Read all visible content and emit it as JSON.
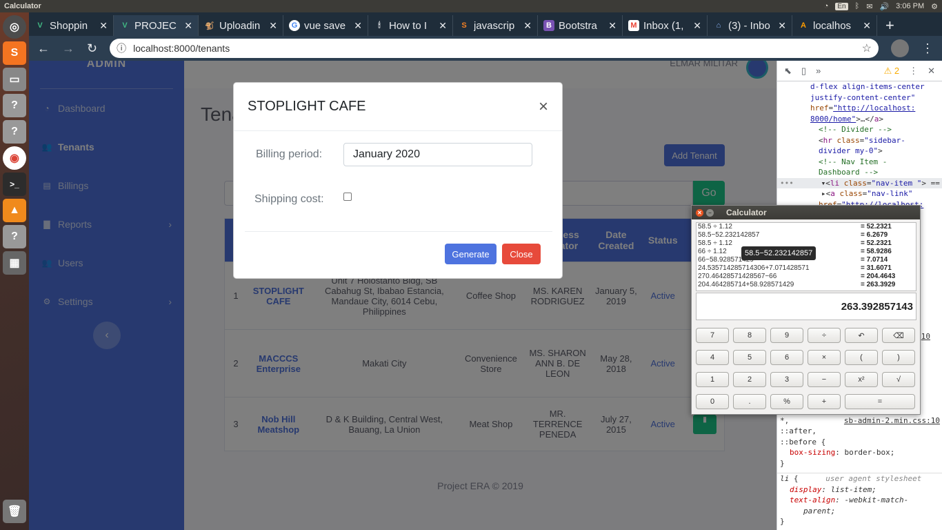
{
  "topbar": {
    "title": "Calculator",
    "kbd": "En",
    "time": "3:06 PM"
  },
  "launcher": [
    "ubuntu-icon",
    "sublime-icon",
    "files-icon",
    "unknown-icon",
    "unknown-icon",
    "chrome-icon",
    "terminal-icon",
    "vlc-icon",
    "unknown-icon",
    "calculator-icon",
    "trash-icon"
  ],
  "tabs": [
    {
      "label": "Shoppin",
      "icon": "V",
      "color": "#41b883"
    },
    {
      "label": "PROJEC",
      "icon": "V",
      "color": "#41b883"
    },
    {
      "label": "Uploadin",
      "icon": "🐒",
      "color": "#f3e2c5"
    },
    {
      "label": "vue save",
      "icon": "G",
      "color": "#ffffff"
    },
    {
      "label": "How to I",
      "icon": "🕯",
      "color": "#2c3e50"
    },
    {
      "label": "javascrip",
      "icon": "S",
      "color": "#f48024"
    },
    {
      "label": "Bootstra",
      "icon": "B",
      "color": "#7952b3"
    },
    {
      "label": "Inbox (1,",
      "icon": "M",
      "color": "#ea4335"
    },
    {
      "label": "(3) - Inbo",
      "icon": "⌂",
      "color": "#8ab4f8"
    },
    {
      "label": "localhos",
      "icon": "A",
      "color": "#ff9c00"
    }
  ],
  "address": {
    "url": "localhost:8000/tenants"
  },
  "sidebar": {
    "brand": "ADMIN",
    "items": [
      {
        "label": "Dashboard",
        "icon": "◔"
      },
      {
        "label": "Tenants",
        "icon": "👥"
      },
      {
        "label": "Billings",
        "icon": "▤"
      },
      {
        "label": "Reports",
        "icon": "▇",
        "chev": "›"
      },
      {
        "label": "Users",
        "icon": "👥"
      },
      {
        "label": "Settings",
        "icon": "⚙",
        "chev": "›"
      }
    ],
    "toggle": "‹"
  },
  "topnav": {
    "user": "ELMAR MILITAR"
  },
  "main": {
    "title": "Tenants",
    "add_tenant": "Add Tenant",
    "go": "Go"
  },
  "table": {
    "headers": [
      "",
      "",
      "",
      "",
      "Business Operator",
      "Date Created",
      "Status",
      ""
    ],
    "rows": [
      {
        "no": "1",
        "name": "STOPLIGHT CAFE",
        "address": "Unit 7 Holostanto Bldg, SB Cabahug St, Ibabao Estancia, Mandaue City, 6014 Cebu, Philippines",
        "type": "Coffee Shop",
        "operator": "MS. KAREN RODRIGUEZ",
        "date": "January 5, 2019",
        "status": "Active"
      },
      {
        "no": "2",
        "name": "MACCCS Enterprise",
        "address": "Makati City",
        "type": "Convenience Store",
        "operator": "MS. SHARON ANN B. DE LEON",
        "date": "May 28, 2018",
        "status": "Active"
      },
      {
        "no": "3",
        "name": "Nob Hill Meatshop",
        "address": "D & K Building, Central West, Bauang, La Union",
        "type": "Meat Shop",
        "operator": "MR. TERRENCE PENEDA",
        "date": "July 27, 2015",
        "status": "Active"
      }
    ]
  },
  "footer": "Project ERA © 2019",
  "modal": {
    "title": "STOPLIGHT CAFE",
    "close_x": "×",
    "billing_label": "Billing period:",
    "billing_value": "January 2020",
    "shipping_label": "Shipping cost:",
    "generate": "Generate",
    "close": "Close"
  },
  "devtools": {
    "warn": "⚠ 2"
  },
  "calc": {
    "title": "Calculator",
    "display": "263.392857143",
    "tooltip": "58.5−52.232142857",
    "history": [
      {
        "e": "58.5 ÷ 1.12",
        "r": "= 52.2321"
      },
      {
        "e": "58.5−52.232142857",
        "r": "= 6.2679"
      },
      {
        "e": "58.5 ÷ 1.12",
        "r": "= 52.2321"
      },
      {
        "e": "66 ÷ 1.12",
        "r": "= 58.9286"
      },
      {
        "e": "66−58.928571429",
        "r": "= 7.0714"
      },
      {
        "e": "24.535714285714306+7.071428571",
        "r": "= 31.6071"
      },
      {
        "e": "270.46428571428567−66",
        "r": "= 204.4643"
      },
      {
        "e": "204.464285714+58.928571429",
        "r": "= 263.3929"
      }
    ],
    "keys": [
      [
        "7",
        "8",
        "9",
        "÷",
        "↶",
        "⌫"
      ],
      [
        "4",
        "5",
        "6",
        "×",
        "(",
        ")"
      ],
      [
        "1",
        "2",
        "3",
        "−",
        "x²",
        "√"
      ],
      [
        "0",
        ".",
        "%",
        "+",
        "="
      ]
    ]
  }
}
